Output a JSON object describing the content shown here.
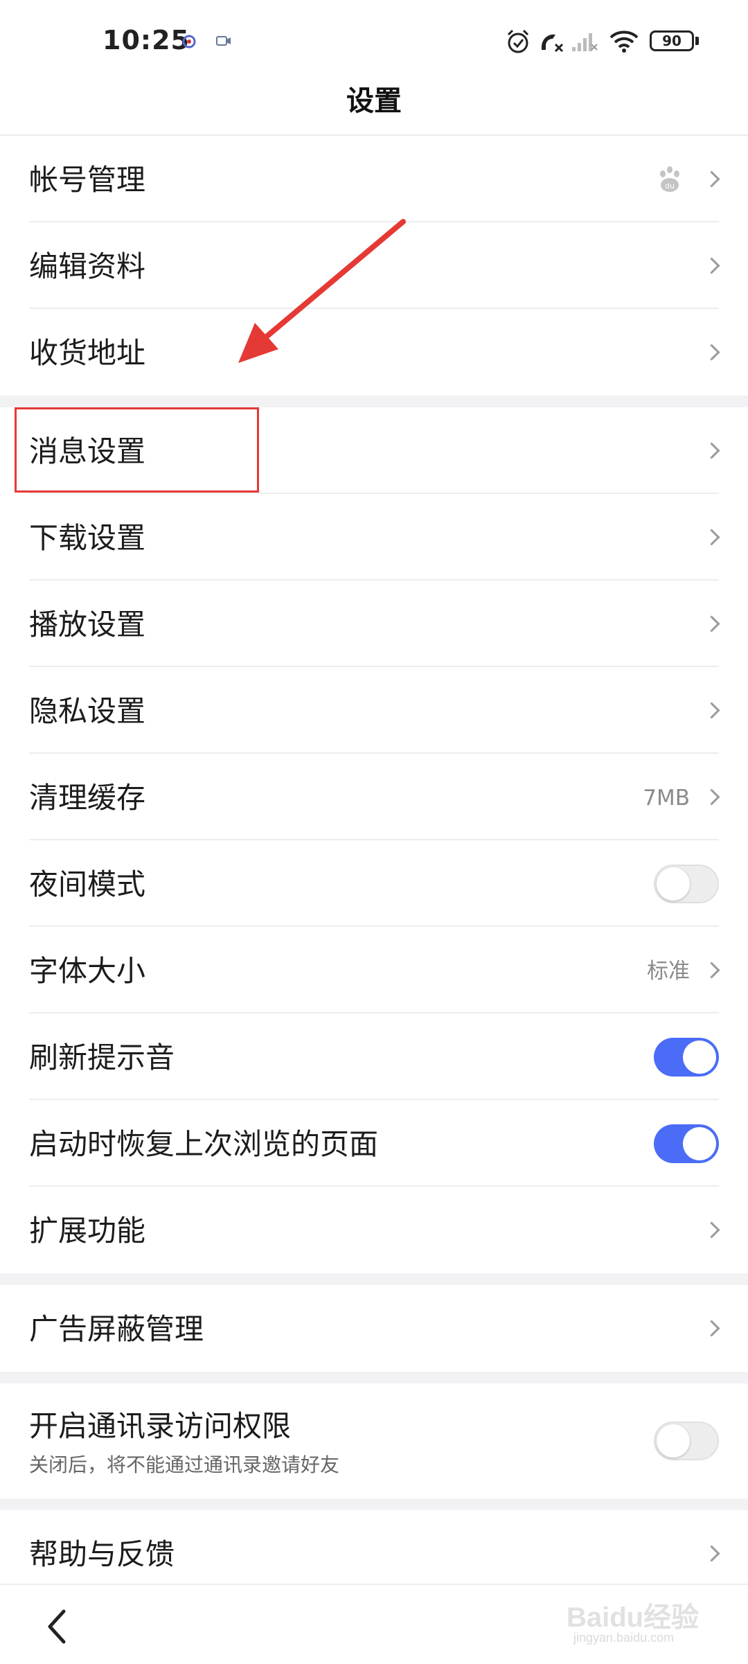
{
  "status_bar": {
    "time": "10:25",
    "battery": "90",
    "icons": [
      "app-notification-icon",
      "video-notification-icon",
      "alarm-icon",
      "missed-call-icon",
      "signal-icon",
      "wifi-icon",
      "battery-icon"
    ]
  },
  "header": {
    "title": "设置"
  },
  "sections": {
    "account": [
      {
        "label": "帐号管理",
        "trailing_icon": "baidu-paw-icon"
      },
      {
        "label": "编辑资料"
      },
      {
        "label": "收货地址"
      }
    ],
    "general": [
      {
        "label": "消息设置"
      },
      {
        "label": "下载设置"
      },
      {
        "label": "播放设置"
      },
      {
        "label": "隐私设置"
      },
      {
        "label": "清理缓存",
        "value": "7MB"
      },
      {
        "label": "夜间模式",
        "toggle": false
      },
      {
        "label": "字体大小",
        "value": "标准"
      },
      {
        "label": "刷新提示音",
        "toggle": true
      },
      {
        "label": "启动时恢复上次浏览的页面",
        "toggle": true
      },
      {
        "label": "扩展功能"
      }
    ],
    "ads": [
      {
        "label": "广告屏蔽管理"
      }
    ],
    "contacts": [
      {
        "label": "开启通讯录访问权限",
        "sublabel": "关闭后，将不能通过通讯录邀请好友",
        "toggle": false
      }
    ],
    "help": [
      {
        "label": "帮助与反馈"
      }
    ]
  },
  "colors": {
    "accent": "#4a6cf7",
    "annotation": "#e53935",
    "background_gap": "#f2f2f4"
  },
  "watermark": {
    "text": "Baidu经验",
    "url": "jingyan.baidu.com"
  }
}
